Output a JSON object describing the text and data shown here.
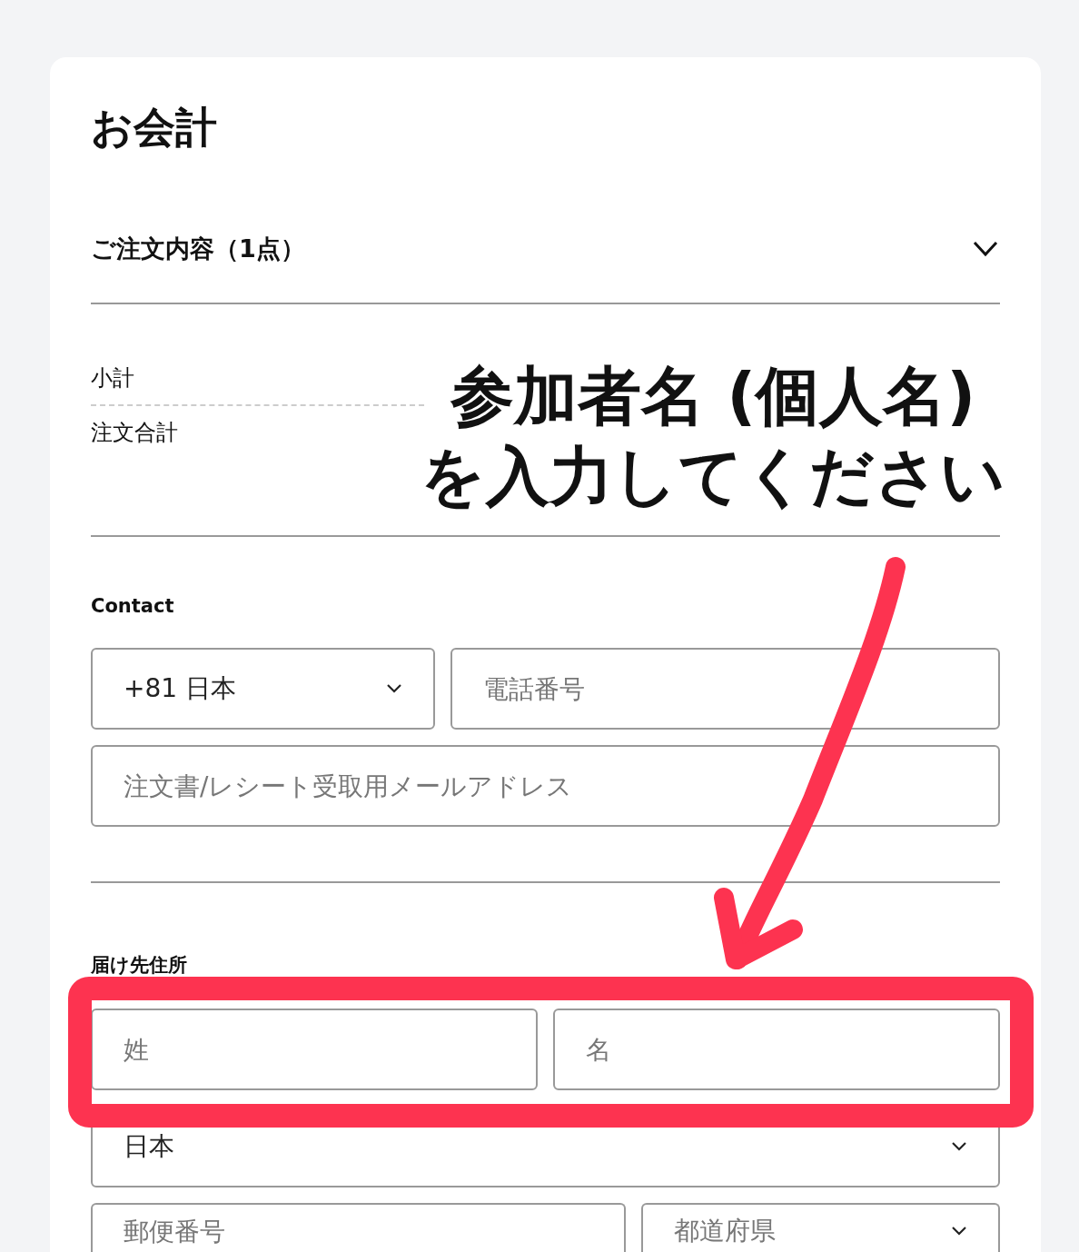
{
  "page": {
    "title": "お会計"
  },
  "order_summary": {
    "label": "ご注文内容（1点）"
  },
  "totals": [
    {
      "label": "小計"
    },
    {
      "label": "注文合計"
    }
  ],
  "contact": {
    "heading": "Contact",
    "country_code": {
      "value": "+81 日本"
    },
    "phone": {
      "placeholder": "電話番号"
    },
    "email": {
      "placeholder": "注文書/レシート受取用メールアドレス"
    }
  },
  "shipping": {
    "heading": "届け先住所",
    "last_name": {
      "placeholder": "姓"
    },
    "first_name": {
      "placeholder": "名"
    },
    "country": {
      "value": "日本"
    },
    "postal_code": {
      "placeholder": "郵便番号"
    },
    "prefecture": {
      "placeholder": "都道府県"
    }
  },
  "annotation": {
    "lines": [
      "参加者名 (個人名)",
      "を入力してください"
    ]
  }
}
